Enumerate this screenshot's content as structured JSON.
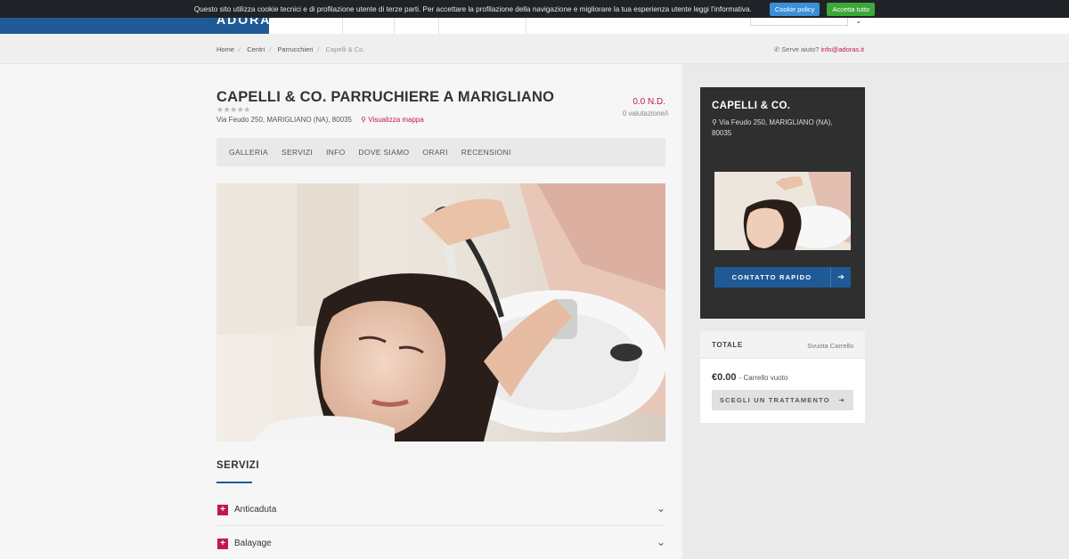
{
  "cookie": {
    "text": "Questo sito utilizza cookie tecnici e di profilazione utente di terze parti. Per accettare la profilazione della navigazione e migliorare la tua esperienza utente leggi l'informativa.",
    "policy_label": "Cookie policy",
    "accept_label": "Accetta tutto"
  },
  "header": {
    "logo": "ADORAS"
  },
  "breadcrumb": {
    "items": [
      "Home",
      "Centri",
      "Parrucchieri"
    ],
    "current": "Capelli & Co."
  },
  "help": {
    "label": "Serve aiuto?",
    "email": "info@adoras.it"
  },
  "salon": {
    "title": "CAPELLI & CO. PARRUCHIERE A MARIGLIANO",
    "stars": "★★★★★",
    "address": "Via Feudo 250, MARIGLIANO (NA), 80035",
    "map_link": "Visualizza mappa",
    "rating": "0.0 N.D.",
    "rating_count": "0 valutazione/i"
  },
  "tabs": [
    "GALLERIA",
    "SERVIZI",
    "INFO",
    "DOVE SIAMO",
    "ORARI",
    "RECENSIONI"
  ],
  "services": {
    "heading": "SERVIZI",
    "items": [
      "Anticaduta",
      "Balayage"
    ]
  },
  "sidebar": {
    "title": "CAPELLI & CO.",
    "address": "Via Feudo 250, MARIGLIANO (NA), 80035",
    "quick_contact": "CONTATTO RAPIDO"
  },
  "cart": {
    "total_label": "TOTALE",
    "empty_label": "Svuota Carrello",
    "price": "€0.00",
    "price_note": "- Carrello vuoto",
    "choose_label": "SCEGLI UN TRATTAMENTO"
  },
  "colors": {
    "brand_blue": "#1f5a96",
    "accent": "#c1184a",
    "dark_card": "#2f2f2f"
  }
}
